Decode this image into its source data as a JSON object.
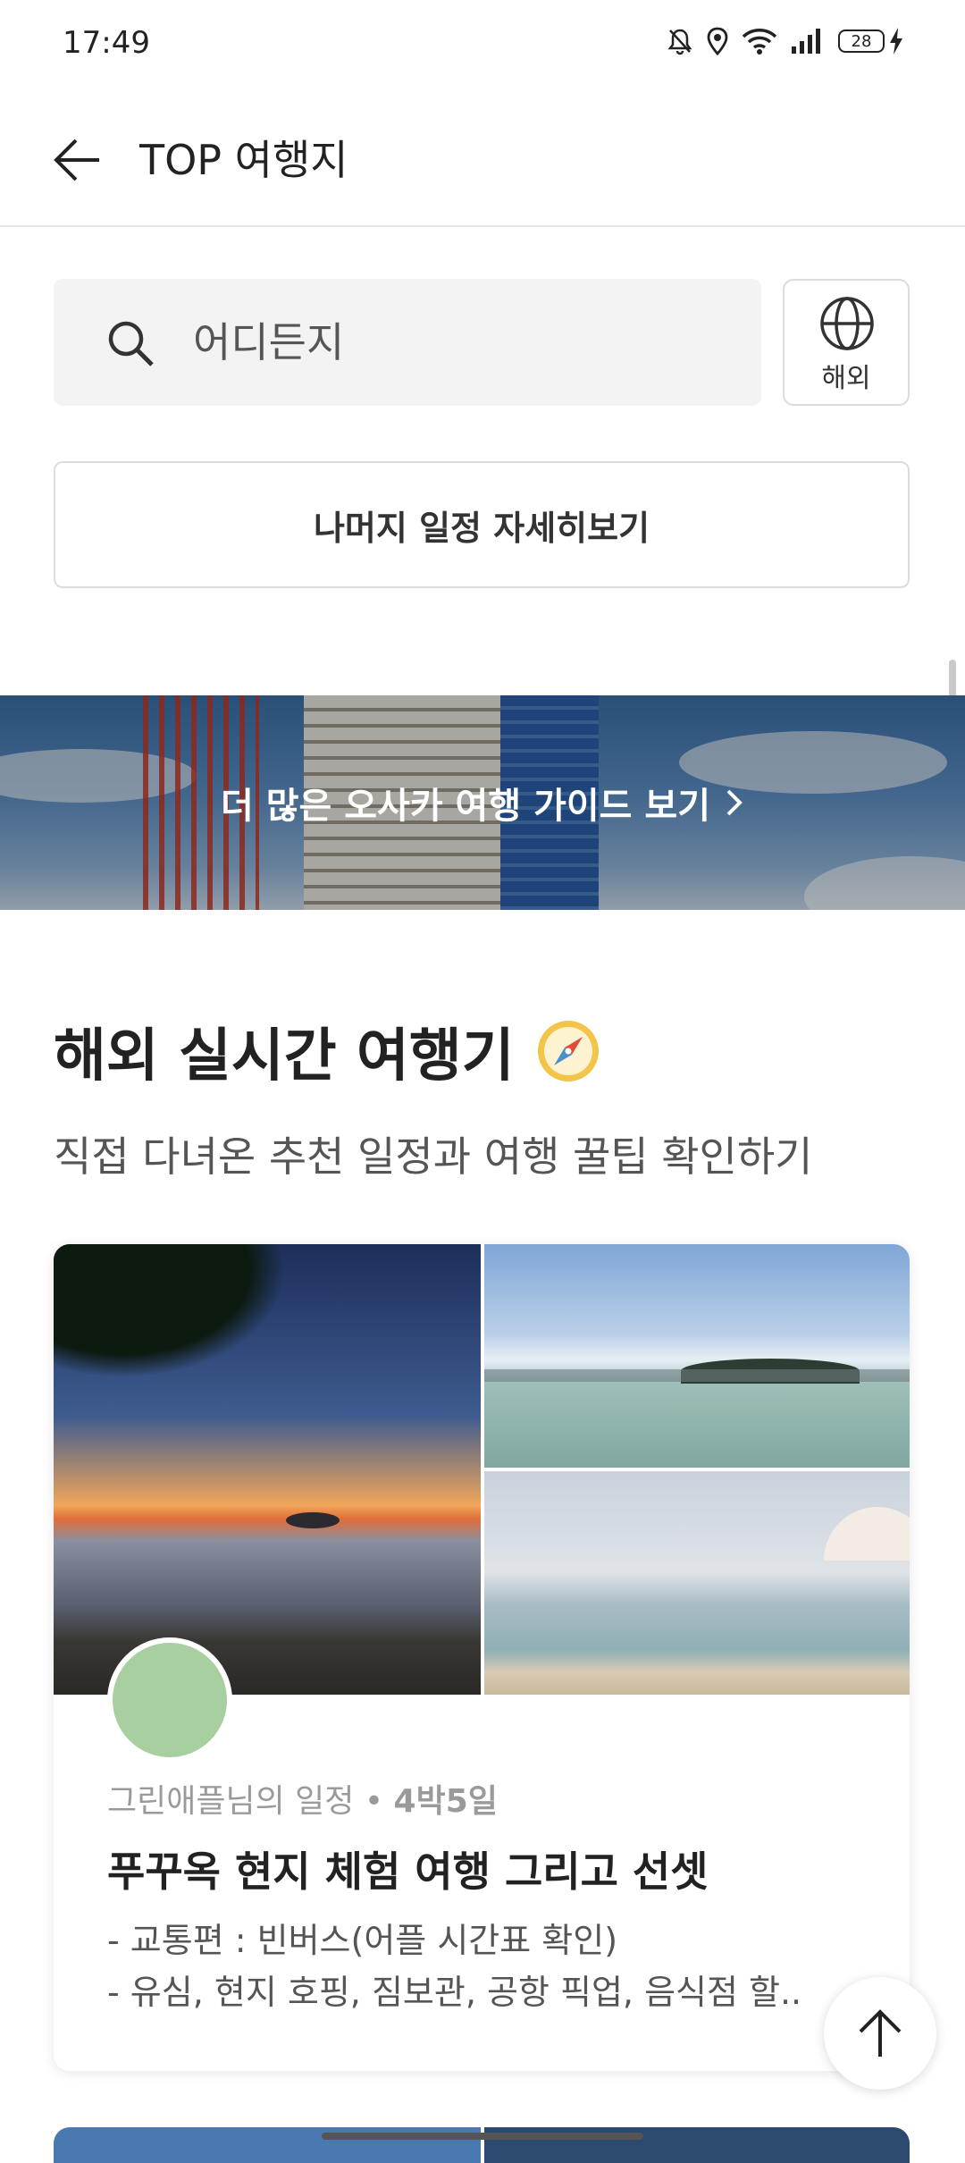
{
  "status_bar": {
    "time": "17:49",
    "battery": "28"
  },
  "header": {
    "title": "TOP 여행지"
  },
  "search": {
    "placeholder": "어디든지",
    "region_button": "해외"
  },
  "more_schedule_button": "나머지 일정 자세히보기",
  "banner": {
    "text": "더 많은 오사카 여행 가이드 보기"
  },
  "section": {
    "title": "해외 실시간 여행기",
    "subtitle": "직접 다녀온 추천 일정과 여행 꿀팁 확인하기"
  },
  "card": {
    "author": "그린애플님의 일정",
    "separator": "•",
    "duration": "4박5일",
    "title": "푸꾸옥 현지 체험 여행 그리고 선셋",
    "desc_line1": "- 교통편 : 빈버스(어플 시간표 확인)",
    "desc_line2": "- 유심, 현지 호핑, 짐보관, 공항 픽업, 음식점 할.."
  },
  "colors": {
    "accent_avatar": "#a7cfa0",
    "banner_text": "#ffffff"
  }
}
